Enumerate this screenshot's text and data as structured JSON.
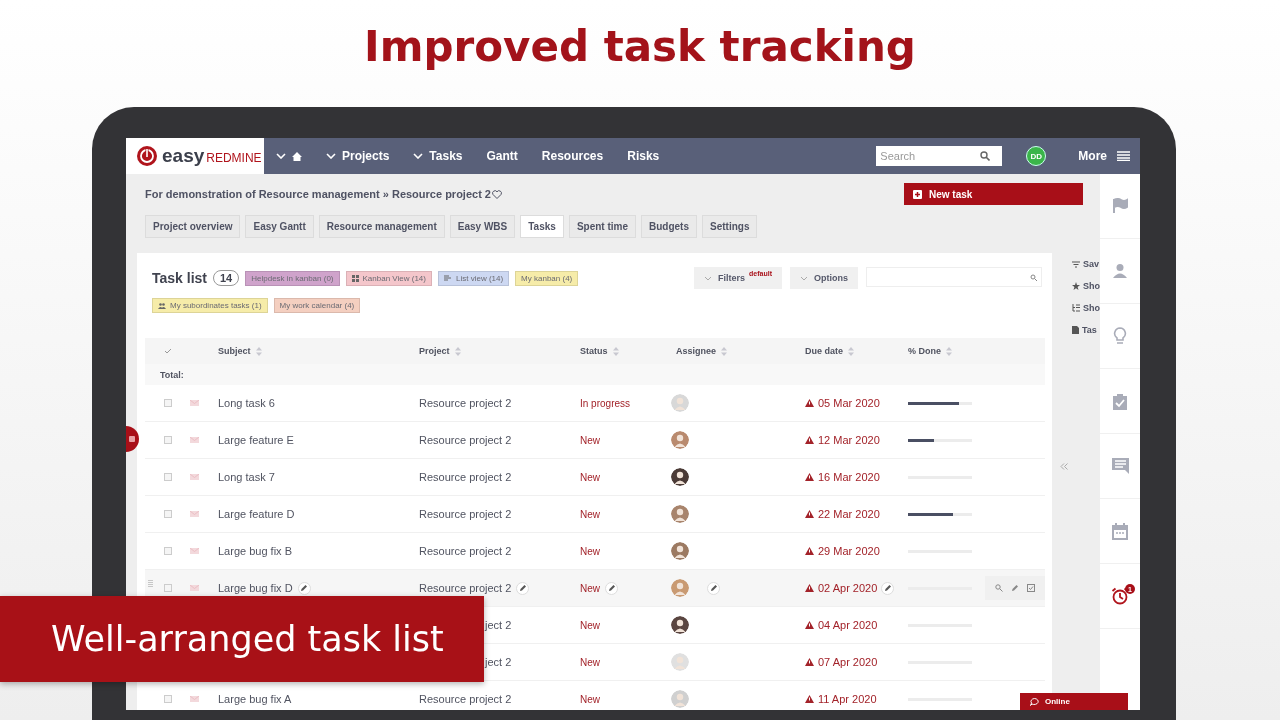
{
  "headline": "Improved task tracking",
  "caption": "Well-arranged task list",
  "app": {
    "logo": {
      "word_1": "easy",
      "word_2": "REDMINE"
    },
    "nav": [
      {
        "label": "Projects",
        "caret": true
      },
      {
        "label": "Tasks",
        "caret": true
      },
      {
        "label": "Gantt",
        "caret": false
      },
      {
        "label": "Resources",
        "caret": false
      },
      {
        "label": "Risks",
        "caret": false
      }
    ],
    "search": {
      "placeholder": "Search"
    },
    "user_initials": "DD",
    "more": "More",
    "breadcrumb": "For demonstration of Resource management » Resource project 2",
    "new_task": "New task",
    "project_tabs": [
      {
        "label": "Project overview",
        "selected": false
      },
      {
        "label": "Easy Gantt",
        "selected": false
      },
      {
        "label": "Resource management",
        "selected": false
      },
      {
        "label": "Easy WBS",
        "selected": false
      },
      {
        "label": "Tasks",
        "selected": true
      },
      {
        "label": "Spent time",
        "selected": false
      },
      {
        "label": "Budgets",
        "selected": false
      },
      {
        "label": "Settings",
        "selected": false
      }
    ],
    "task_list": {
      "title": "Task list",
      "count": "14",
      "tags": [
        {
          "label": "Helpdesk in kanban (0)",
          "kind": "plain",
          "color": "#cfa3cb"
        },
        {
          "label": "Kanban View (14)",
          "kind": "grid",
          "color": "#f4c6cb"
        },
        {
          "label": "List view (14)",
          "kind": "list",
          "color": "#cdd8f2"
        },
        {
          "label": "My kanban (4)",
          "kind": "plain",
          "color": "#f6eca9"
        },
        {
          "label": "My subordinates tasks (1)",
          "kind": "people",
          "color": "#f6eca9"
        },
        {
          "label": "My work calendar (4)",
          "kind": "plain",
          "color": "#f4cfc0"
        }
      ],
      "filters": "Filters",
      "filters_badge": "default",
      "options": "Options"
    },
    "side_links": [
      {
        "label": "Sav",
        "kind": "filter"
      },
      {
        "label": "Sho",
        "kind": "star"
      },
      {
        "label": "Sho",
        "kind": "tree"
      },
      {
        "label": "Tas",
        "kind": "doc"
      }
    ],
    "columns": [
      "Subject",
      "Project",
      "Status",
      "Assignee",
      "Due date",
      "% Done"
    ],
    "total_label": "Total:",
    "rows": [
      {
        "subject": "Long task 6",
        "project": "Resource project 2",
        "status": "In progress",
        "due": "05 Mar 2020",
        "level": 0.8,
        "hovered": false
      },
      {
        "subject": "Large feature E",
        "project": "Resource project 2",
        "status": "New",
        "due": "12 Mar 2020",
        "level": 0.4,
        "hovered": false
      },
      {
        "subject": "Long task 7",
        "project": "Resource project 2",
        "status": "New",
        "due": "16 Mar 2020",
        "level": 0,
        "hovered": false
      },
      {
        "subject": "Large feature D",
        "project": "Resource project 2",
        "status": "New",
        "due": "22 Mar 2020",
        "level": 0.7,
        "hovered": false
      },
      {
        "subject": "Large bug fix B",
        "project": "Resource project 2",
        "status": "New",
        "due": "29 Mar 2020",
        "level": 0,
        "hovered": false
      },
      {
        "subject": "Large bug fix D",
        "project": "Resource project 2",
        "status": "New",
        "due": "02 Apr 2020",
        "level": 0,
        "hovered": true
      },
      {
        "project": "ject 2",
        "status": "New",
        "due": "04 Apr 2020",
        "level": 0,
        "hovered": false
      },
      {
        "project": "ject 2",
        "status": "New",
        "due": "07 Apr 2020",
        "level": 0,
        "hovered": false
      },
      {
        "subject": "Large bug fix A",
        "project": "Resource project 2",
        "status": "New",
        "due": "11 Apr 2020",
        "level": 0,
        "hovered": false
      }
    ],
    "alarm_badge": "1",
    "online": "Online"
  }
}
